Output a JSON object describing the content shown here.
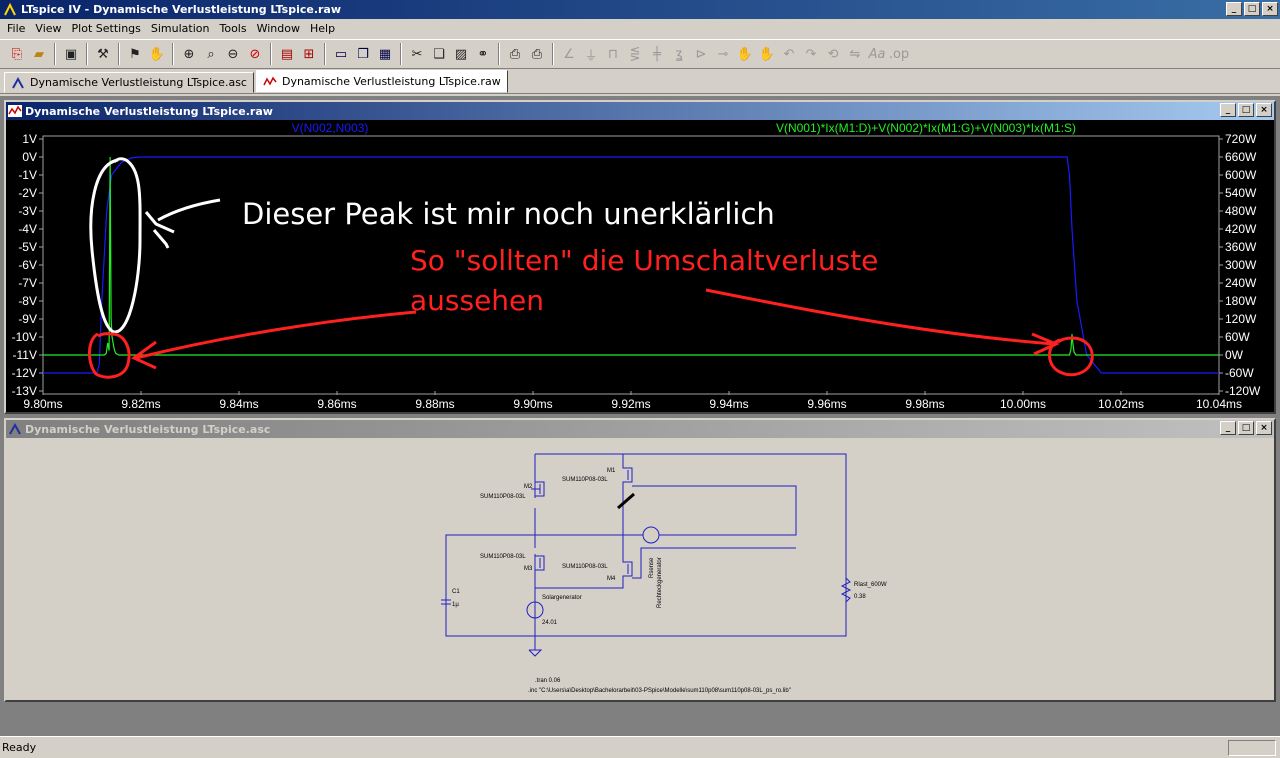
{
  "window": {
    "title": "LTspice IV - Dynamische Verlustleistung LTspice.raw"
  },
  "menu": [
    "File",
    "View",
    "Plot Settings",
    "Simulation",
    "Tools",
    "Window",
    "Help"
  ],
  "tabs": [
    {
      "label": "Dynamische Verlustleistung LTspice.asc",
      "active": false
    },
    {
      "label": "Dynamische Verlustleistung LTspice.raw",
      "active": true
    }
  ],
  "plot_window": {
    "title": "Dynamische Verlustleistung LTspice.raw",
    "trace1": {
      "name": "V(N002,N003)",
      "color": "#1a1aff"
    },
    "trace2": {
      "name": "V(N001)*Ix(M1:D)+V(N002)*Ix(M1:G)+V(N003)*Ix(M1:S)",
      "color": "#22ee22"
    },
    "y_left_ticks": [
      "1V",
      "0V",
      "-1V",
      "-2V",
      "-3V",
      "-4V",
      "-5V",
      "-6V",
      "-7V",
      "-8V",
      "-9V",
      "-10V",
      "-11V",
      "-12V",
      "-13V"
    ],
    "y_right_ticks": [
      "720W",
      "660W",
      "600W",
      "540W",
      "480W",
      "420W",
      "360W",
      "300W",
      "240W",
      "180W",
      "120W",
      "60W",
      "0W",
      "-60W",
      "-120W"
    ],
    "x_ticks": [
      "9.80ms",
      "9.82ms",
      "9.84ms",
      "9.86ms",
      "9.88ms",
      "9.90ms",
      "9.92ms",
      "9.94ms",
      "9.96ms",
      "9.98ms",
      "10.00ms",
      "10.02ms",
      "10.04ms"
    ],
    "annotation_white": "Dieser Peak ist mir noch unerklärlich",
    "annotation_red_line1": "So \"sollten\" die Umschaltverluste",
    "annotation_red_line2": "aussehen"
  },
  "chart_data": {
    "type": "line",
    "xlabel": "",
    "x_unit": "ms",
    "xlim": [
      9.8,
      10.04
    ],
    "ylim_left": [
      -13,
      1
    ],
    "ylim_right": [
      -120,
      720
    ],
    "series": [
      {
        "name": "V(N002,N003)",
        "axis": "left",
        "x": [
          9.8,
          9.811,
          9.8115,
          9.812,
          9.813,
          9.814,
          9.816,
          9.818,
          9.82,
          10.005,
          10.009,
          10.0095,
          10.01,
          10.011,
          10.013,
          10.016,
          10.04
        ],
        "y": [
          -12,
          -12,
          -11.5,
          -8,
          -3,
          -1,
          -0.3,
          -0.05,
          0,
          0,
          0,
          -1,
          -4,
          -8,
          -11,
          -12,
          -12
        ]
      },
      {
        "name": "V(N001)*Ix(M1:D)+V(N002)*Ix(M1:G)+V(N003)*Ix(M1:S)",
        "axis": "right",
        "x": [
          9.8,
          9.8125,
          9.8129,
          9.8132,
          9.8135,
          9.8137,
          9.8139,
          9.8141,
          9.8143,
          9.8146,
          9.8149,
          9.8155,
          10.0095,
          10.0098,
          10.01,
          10.0102,
          10.0104,
          10.0108,
          10.04
        ],
        "y": [
          0,
          0,
          5,
          40,
          15,
          660,
          120,
          60,
          40,
          15,
          5,
          0,
          0,
          20,
          70,
          35,
          10,
          0,
          0
        ]
      }
    ]
  },
  "schematic_window": {
    "title": "Dynamische Verlustleistung LTspice.asc",
    "labels": {
      "m1": "M1",
      "m2": "M2",
      "m3": "M3",
      "m4": "M4",
      "part_m1": "SUM110P08-03L",
      "part_m2": "SUM110P08-03L",
      "part_m3": "SUM110P08-03L",
      "part_m4": "SUM110P08-03L",
      "rlast": "Rlast_600W",
      "rlast_val": "0.38",
      "c1": "C1",
      "c1_val": "1µ",
      "vsrc": "Solargenerator",
      "vsrc_val": "24.01",
      "isrc": "Rechteckgenerator",
      "isrc_name": "Rsense",
      "tran": ".tran 0.06",
      "inc": ".inc \"C:\\Users\\a\\Desktop\\Bachelorarbeit\\03-PSpice\\Modelle\\sum110p08\\sum110p08-03L_ps_ro.lib\""
    }
  },
  "status": {
    "text": "Ready"
  }
}
